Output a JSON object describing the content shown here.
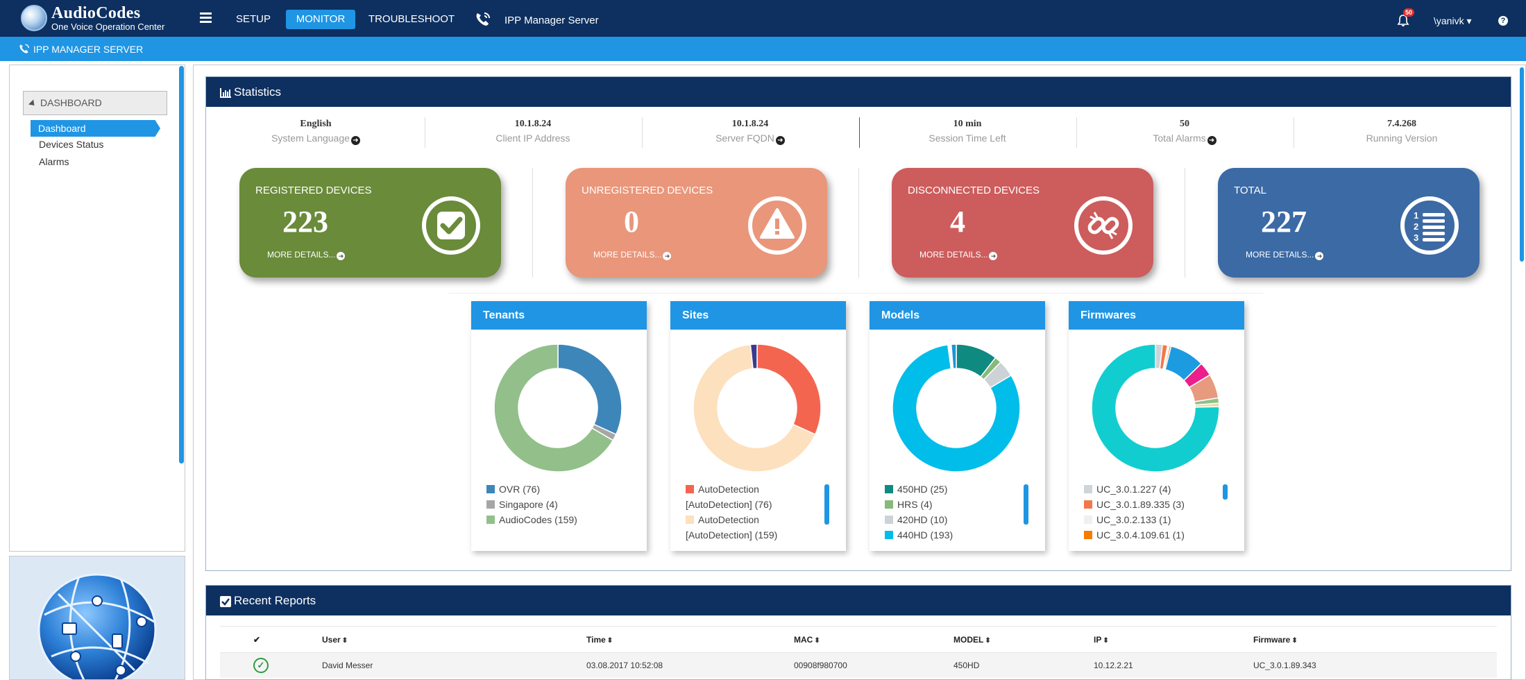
{
  "app": {
    "brand": "AudioCodes",
    "subtitle": "One Voice Operation Center",
    "nav": {
      "setup": "SETUP",
      "monitor": "MONITOR",
      "troubleshoot": "TROUBLESHOOT"
    },
    "server_name": "IPP Manager Server",
    "alarm_badge": "50",
    "user": "\\yanivk",
    "help": "?",
    "subbar_title": "IPP MANAGER SERVER"
  },
  "sidebar": {
    "section": "DASHBOARD",
    "items": [
      {
        "label": "Dashboard",
        "active": true
      },
      {
        "label": "Devices Status"
      },
      {
        "label": "Alarms"
      }
    ]
  },
  "statistics": {
    "title": "Statistics",
    "cells": [
      {
        "value": "English",
        "label": "System Language",
        "link": true
      },
      {
        "value": "10.1.8.24",
        "label": "Client IP Address"
      },
      {
        "value": "10.1.8.24",
        "label": "Server FQDN",
        "link": true
      },
      {
        "value": "10 min",
        "label": "Session Time Left"
      },
      {
        "value": "50",
        "label": "Total Alarms",
        "link": true
      },
      {
        "value": "7.4.268",
        "label": "Running Version"
      }
    ],
    "cards": [
      {
        "title": "REGISTERED DEVICES",
        "count": "223",
        "more": "MORE DETAILS...",
        "color": "#6a8b3a",
        "icon": "check-square-icon"
      },
      {
        "title": "UNREGISTERED DEVICES",
        "count": "0",
        "more": "MORE DETAILS...",
        "color": "#e9967a",
        "icon": "warning-icon"
      },
      {
        "title": "DISCONNECTED DEVICES",
        "count": "4",
        "more": "MORE DETAILS...",
        "color": "#cd5c5c",
        "icon": "broken-link-icon"
      },
      {
        "title": "TOTAL",
        "count": "227",
        "more": "MORE DETAILS...",
        "color": "#3b6aa5",
        "icon": "numbered-list-icon"
      }
    ]
  },
  "chart_data": [
    {
      "type": "pie",
      "title": "Tenants",
      "donut": true,
      "series": [
        {
          "name": "OVR (76)",
          "value": 76,
          "color": "#3d86b9"
        },
        {
          "name": "Singapore (4)",
          "value": 4,
          "color": "#a6a6a6"
        },
        {
          "name": "AudioCodes (159)",
          "value": 159,
          "color": "#92bf8a"
        }
      ],
      "legend_lines": [
        [
          {
            "text": "OVR (76)",
            "color": "#3d86b9"
          }
        ],
        [
          {
            "text": "Singapore (4)",
            "color": "#a6a6a6"
          }
        ],
        [
          {
            "text": "AudioCodes (159)",
            "color": "#92bf8a"
          }
        ]
      ]
    },
    {
      "type": "pie",
      "title": "Sites",
      "donut": true,
      "series": [
        {
          "name": "AutoDetection [AutoDetection] (76)",
          "value": 76,
          "color": "#f4654f"
        },
        {
          "name": "AutoDetection [AutoDetection] (159)",
          "value": 159,
          "color": "#fde0bd"
        },
        {
          "name": "",
          "value": 4,
          "color": "#3a3a8c"
        }
      ],
      "legend_lines": [
        [
          {
            "text": "AutoDetection",
            "color": "#f4654f"
          }
        ],
        [
          {
            "text": "[AutoDetection] (76)",
            "color": null
          }
        ],
        [
          {
            "text": "AutoDetection",
            "color": "#fde0bd"
          }
        ],
        [
          {
            "text": "[AutoDetection] (159)",
            "color": null
          }
        ]
      ]
    },
    {
      "type": "pie",
      "title": "Models",
      "donut": true,
      "series": [
        {
          "name": "450HD (25)",
          "value": 25,
          "color": "#0f8a80"
        },
        {
          "name": "HRS (4)",
          "value": 4,
          "color": "#86b97a"
        },
        {
          "name": "420HD (10)",
          "value": 10,
          "color": "#cdd2d6"
        },
        {
          "name": "440HD (193)",
          "value": 193,
          "color": "#00bde9"
        },
        {
          "name": "",
          "value": 2,
          "color": "#ffffff"
        },
        {
          "name": "",
          "value": 3,
          "color": "#1e95d4"
        }
      ],
      "legend_lines": [
        [
          {
            "text": "450HD (25)",
            "color": "#0f8a80"
          }
        ],
        [
          {
            "text": "HRS (4)",
            "color": "#86b97a"
          }
        ],
        [
          {
            "text": "420HD (10)",
            "color": "#cdd2d6"
          }
        ],
        [
          {
            "text": "440HD (193)",
            "color": "#00bde9"
          }
        ]
      ]
    },
    {
      "type": "pie",
      "title": "Firmwares",
      "donut": true,
      "series": [
        {
          "name": "UC_3.0.1.227 (4)",
          "value": 4,
          "color": "#cfd4d8"
        },
        {
          "name": "UC_3.0.1.89.335 (3)",
          "value": 3,
          "color": "#f2784b"
        },
        {
          "name": "UC_3.0.2.133 (1)",
          "value": 1,
          "color": "#eef0f2"
        },
        {
          "name": "UC_3.0.4.109.61 (1)",
          "value": 1,
          "color": "#f57c00"
        },
        {
          "name": "",
          "value": 20,
          "color": "#1d9be0"
        },
        {
          "name": "",
          "value": 8,
          "color": "#ec1e8c"
        },
        {
          "name": "",
          "value": 14,
          "color": "#e79a7e"
        },
        {
          "name": "",
          "value": 3,
          "color": "#8fc08a"
        },
        {
          "name": "",
          "value": 2,
          "color": "#e0e0a0"
        },
        {
          "name": "",
          "value": 171,
          "color": "#12cdcf"
        }
      ],
      "legend_lines": [
        [
          {
            "text": "UC_3.0.1.227 (4)",
            "color": "#cfd4d8"
          }
        ],
        [
          {
            "text": "UC_3.0.1.89.335 (3)",
            "color": "#f2784b"
          }
        ],
        [
          {
            "text": "UC_3.0.2.133 (1)",
            "color": "#eef0f2"
          }
        ],
        [
          {
            "text": "UC_3.0.4.109.61 (1)",
            "color": "#f57c00"
          }
        ]
      ]
    }
  ],
  "reports": {
    "title": "Recent Reports",
    "columns": [
      "",
      "User",
      "Time",
      "MAC",
      "MODEL",
      "IP",
      "Firmware"
    ],
    "rows": [
      {
        "status": "ok",
        "user": "David Messer",
        "time": "03.08.2017 10:52:08",
        "mac": "00908f980700",
        "model": "450HD",
        "ip": "10.12.2.21",
        "firmware": "UC_3.0.1.89.343"
      }
    ]
  }
}
